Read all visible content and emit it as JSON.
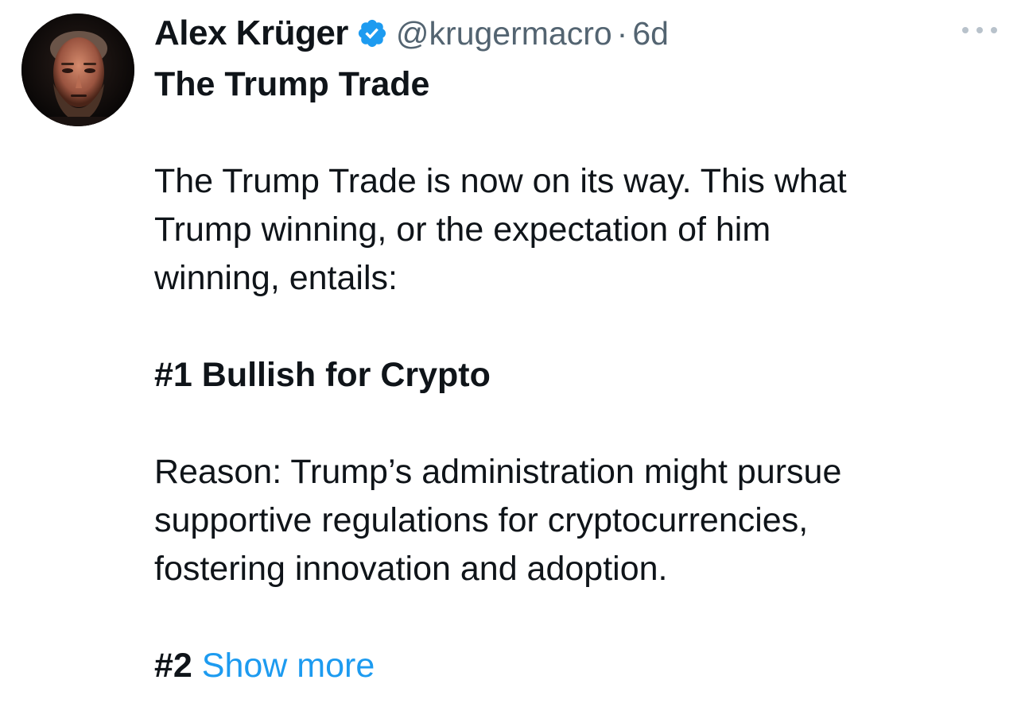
{
  "author": {
    "display_name": "Alex Krüger",
    "handle": "@krugermacro",
    "separator": "·",
    "time": "6d",
    "verified": true,
    "verified_color": "#1d9bf0"
  },
  "tweet": {
    "title": "The Trump Trade",
    "paragraph1_lines": [
      "The Trump Trade is now on its way. This what",
      "Trump winning, or the expectation of him",
      "winning, entails:"
    ],
    "point1_heading": "#1 Bullish for Crypto",
    "reason_lines": [
      "Reason: Trump’s administration might pursue",
      "supportive regulations for cryptocurrencies,",
      "fostering innovation and adoption."
    ],
    "point2_prefix": "#2",
    "show_more_label": "Show more",
    "show_more_color": "#1d9bf0"
  },
  "icons": {
    "more": "more-horizontal-icon",
    "verified": "verified-badge-icon"
  }
}
